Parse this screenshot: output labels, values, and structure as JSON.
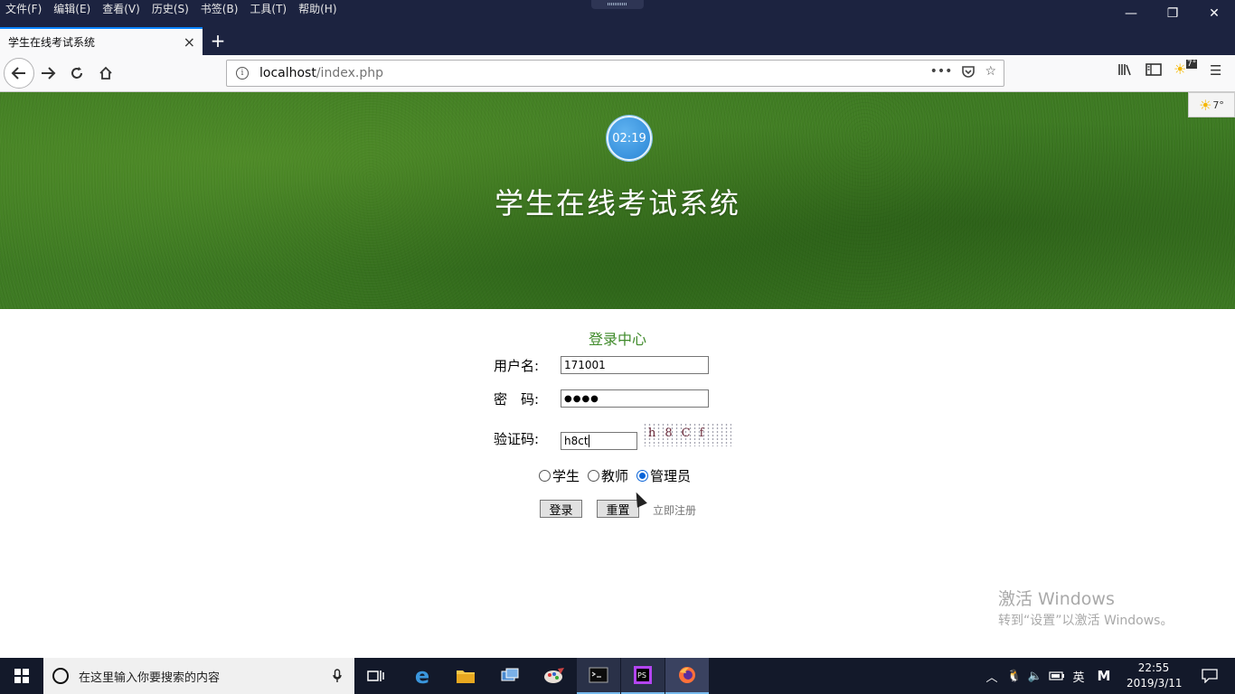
{
  "browser": {
    "menu": [
      "文件(F)",
      "编辑(E)",
      "查看(V)",
      "历史(S)",
      "书签(B)",
      "工具(T)",
      "帮助(H)"
    ],
    "tab_title": "学生在线考试系统",
    "url_host": "localhost",
    "url_path": "/index.php",
    "weather_temp": "7°"
  },
  "banner": {
    "clock": "02:19",
    "title": "学生在线考试系统"
  },
  "login": {
    "heading": "登录中心",
    "username_label": "用户名:",
    "username_value": "171001",
    "password_label": "密　码:",
    "password_value": "●●●●",
    "captcha_label": "验证码:",
    "captcha_value": "h8ct",
    "captcha_image_text": "h8Cf",
    "roles": [
      {
        "label": "学生",
        "checked": false
      },
      {
        "label": "教师",
        "checked": false
      },
      {
        "label": "管理员",
        "checked": true
      }
    ],
    "login_button": "登录",
    "reset_button": "重置",
    "register_link": "立即注册"
  },
  "watermark": {
    "line1": "激活 Windows",
    "line2": "转到“设置”以激活 Windows。"
  },
  "taskbar": {
    "search_placeholder": "在这里输入你要搜索的内容",
    "ime": "英",
    "time": "22:55",
    "date": "2019/3/11"
  }
}
